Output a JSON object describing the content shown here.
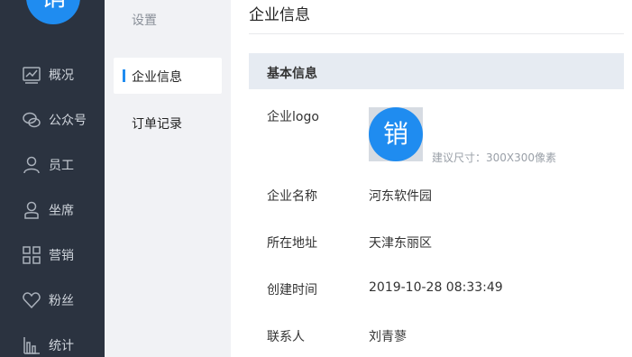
{
  "nav": {
    "logo_glyph": "销",
    "items": [
      {
        "label": "概况",
        "icon": "dashboard-icon"
      },
      {
        "label": "公众号",
        "icon": "wechat-icon"
      },
      {
        "label": "员工",
        "icon": "user-icon"
      },
      {
        "label": "坐席",
        "icon": "seat-icon"
      },
      {
        "label": "营销",
        "icon": "grid-icon"
      },
      {
        "label": "粉丝",
        "icon": "heart-icon"
      },
      {
        "label": "统计",
        "icon": "bar-chart-icon"
      }
    ]
  },
  "subnav": {
    "title": "设置",
    "items": [
      {
        "label": "企业信息",
        "active": true
      },
      {
        "label": "订单记录",
        "active": false
      }
    ]
  },
  "main": {
    "title": "企业信息",
    "section": "基本信息",
    "logo_label": "企业logo",
    "logo_glyph": "销",
    "logo_hint": "建议尺寸：300X300像素",
    "fields": [
      {
        "label": "企业名称",
        "value": "河东软件园"
      },
      {
        "label": "所在地址",
        "value": "天津东丽区"
      },
      {
        "label": "创建时间",
        "value": "2019-10-28 08:33:49"
      },
      {
        "label": "联系人",
        "value": "刘青蓼"
      }
    ]
  },
  "colors": {
    "nav_bg": "#2b3340",
    "accent": "#1f8cf0",
    "subnav_bg": "#f1f2f5",
    "section_bg": "#e6ebf2"
  }
}
